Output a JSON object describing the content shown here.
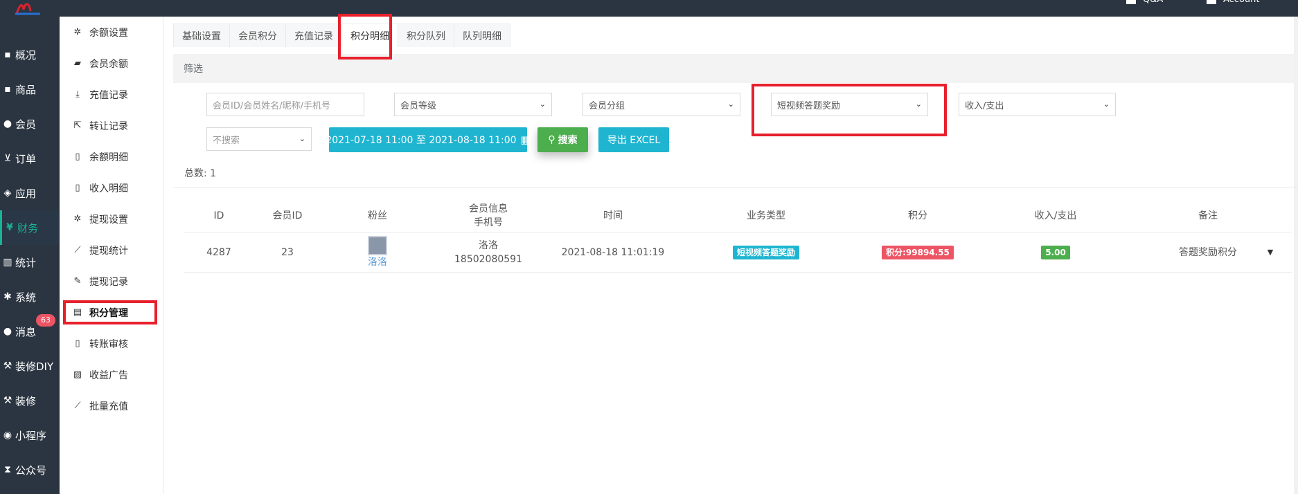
{
  "nav": {
    "items": [
      {
        "label": "概况",
        "icon": "box-icon"
      },
      {
        "label": "商品",
        "icon": "box-icon"
      },
      {
        "label": "会员",
        "icon": "users-icon"
      },
      {
        "label": "订单",
        "icon": "cart-icon"
      },
      {
        "label": "应用",
        "icon": "cubes-icon"
      },
      {
        "label": "财务",
        "icon": "yen-icon",
        "active": true
      },
      {
        "label": "统计",
        "icon": "bar-chart-icon"
      },
      {
        "label": "系统",
        "icon": "cogs-icon"
      },
      {
        "label": "消息",
        "icon": "comment-icon"
      },
      {
        "label": "装修DIY",
        "icon": "gavel-icon"
      },
      {
        "label": "装修",
        "icon": "gavel-icon"
      },
      {
        "label": "小程序",
        "icon": "wechat-icon"
      },
      {
        "label": "公众号",
        "icon": "hourglass-icon"
      }
    ],
    "message_badge": "63",
    "active_color": "#1ab394"
  },
  "subnav": {
    "items": [
      {
        "label": "余额设置",
        "icon": "gear-icon"
      },
      {
        "label": "会员余额",
        "icon": "book-icon"
      },
      {
        "label": "充值记录",
        "icon": "download-icon"
      },
      {
        "label": "转让记录",
        "icon": "external-link-icon"
      },
      {
        "label": "余额明细",
        "icon": "file-icon"
      },
      {
        "label": "收入明细",
        "icon": "file-icon"
      },
      {
        "label": "提现设置",
        "icon": "gear-icon"
      },
      {
        "label": "提现统计",
        "icon": "line-chart-icon"
      },
      {
        "label": "提现记录",
        "icon": "pencil-icon"
      },
      {
        "label": "积分管理",
        "icon": "database-icon",
        "active": true
      },
      {
        "label": "转账审核",
        "icon": "file-icon"
      },
      {
        "label": "收益广告",
        "icon": "image-icon"
      },
      {
        "label": "批量充值",
        "icon": "line-chart-icon"
      }
    ]
  },
  "tabs": [
    "基础设置",
    "会员积分",
    "充值记录",
    "积分明细",
    "积分队列",
    "队列明细"
  ],
  "active_tab": 3,
  "filter": {
    "title": "筛选",
    "member_placeholder": "会员ID/会员姓名/昵称/手机号",
    "level": "会员等级",
    "group": "会员分组",
    "business_type": "短视频答题奖励",
    "in_out": "收入/支出",
    "search_scope": "不搜索",
    "date_range": "2021-07-18 11:00 至 2021-08-18 11:00",
    "search_label": "搜索",
    "export_label": "导出 EXCEL"
  },
  "total_label": "总数:",
  "total_value": "1",
  "table": {
    "headers": {
      "id": "ID",
      "member_id": "会员ID",
      "fans": "粉丝",
      "member_info": "会员信息",
      "phone": "手机号",
      "time": "时间",
      "business_type": "业务类型",
      "points": "积分",
      "in_out": "收入/支出",
      "remark": "备注"
    },
    "rows": [
      {
        "id": "4287",
        "member_id": "23",
        "fan_name": "洛洛",
        "member_name": "洛洛",
        "phone": "18502080591",
        "time": "2021-08-18 11:01:19",
        "business_type": "短视频答题奖励",
        "points": "积分:99894.55",
        "in_out": "5.00",
        "remark": "答题奖励积分"
      }
    ]
  }
}
